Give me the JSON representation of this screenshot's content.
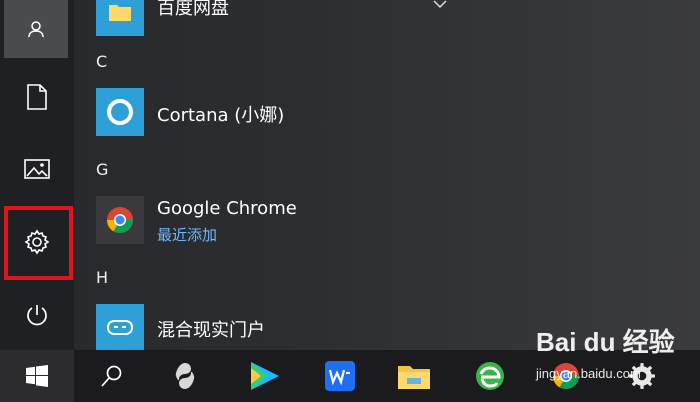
{
  "start_menu": {
    "sidebar": [
      {
        "name": "user-account",
        "icon": "user-icon"
      },
      {
        "name": "documents",
        "icon": "document-icon"
      },
      {
        "name": "pictures",
        "icon": "picture-icon"
      },
      {
        "name": "settings",
        "icon": "gear-icon",
        "highlighted": true
      },
      {
        "name": "power",
        "icon": "power-icon"
      }
    ],
    "apps": {
      "top_item": "百度网盘",
      "group_c": "C",
      "cortana": "Cortana (小娜)",
      "group_g": "G",
      "chrome": "Google Chrome",
      "chrome_sub": "最近添加",
      "group_h": "H",
      "mixed_reality": "混合现实门户"
    }
  },
  "taskbar": {
    "items": [
      "windows-start-icon",
      "search-icon",
      "app-icon",
      "video-player-icon",
      "wps-icon",
      "file-explorer-icon",
      "green-browser-icon",
      "chrome-icon",
      "gear-icon"
    ]
  },
  "watermark": {
    "brand": "Bai du 经验",
    "sub": "jingyan.baidu.com"
  },
  "colors": {
    "accent": "#2f9fd8",
    "highlight_box": "#e0151b",
    "link": "#6fb7ff"
  }
}
